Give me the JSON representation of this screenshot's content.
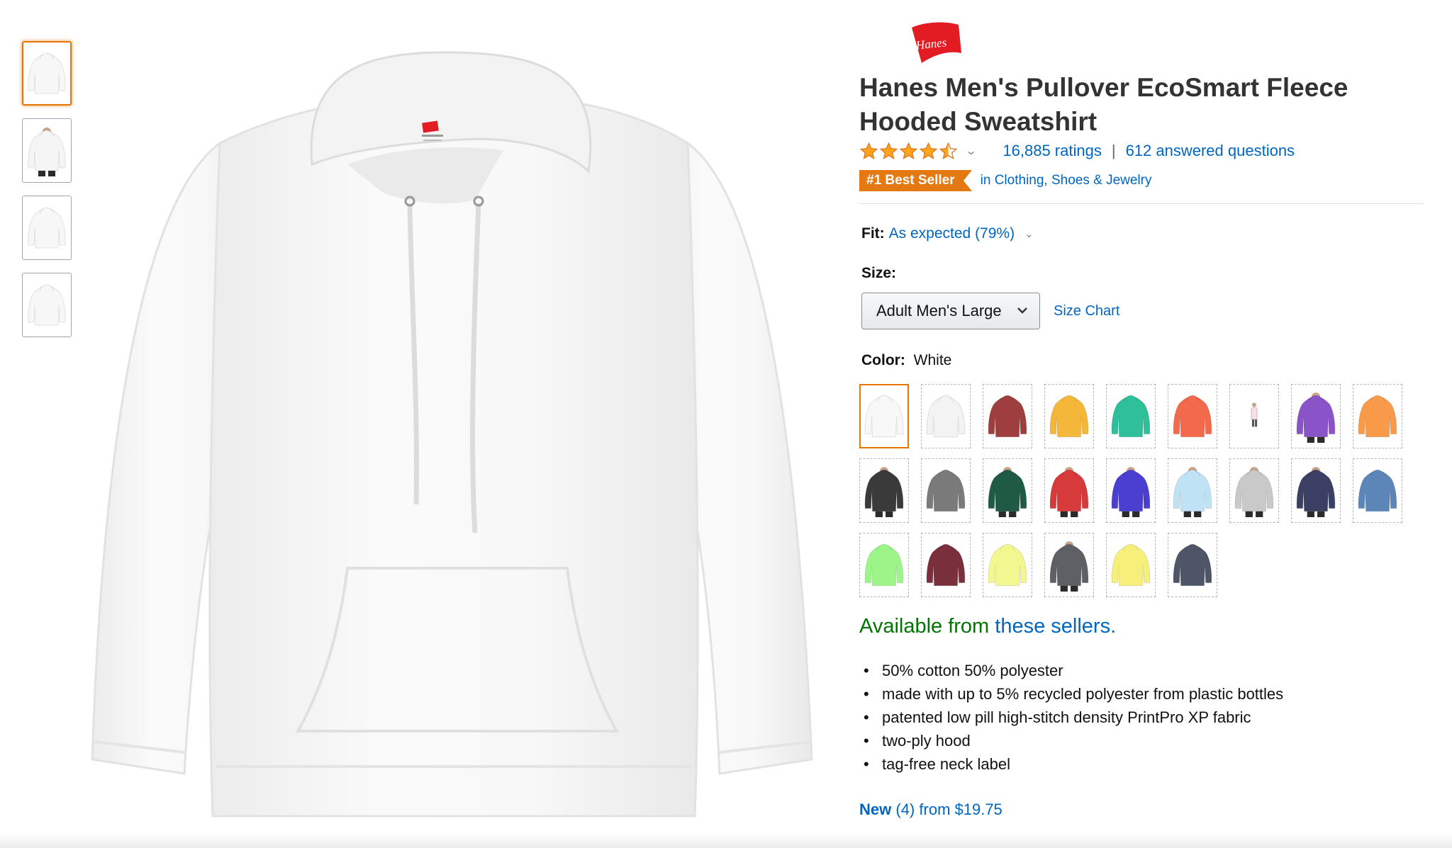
{
  "thumbnails": [
    {
      "name": "thumb-front-white",
      "selected": true,
      "body": "#f7f7f7",
      "person": false
    },
    {
      "name": "thumb-model-white",
      "selected": false,
      "body": "#f5f5f5",
      "person": true
    },
    {
      "name": "thumb-back-white",
      "selected": false,
      "body": "#f7f7f7",
      "person": false
    },
    {
      "name": "thumb-flat-white",
      "selected": false,
      "body": "#f7f7f7",
      "person": false
    }
  ],
  "brand": {
    "logo_text": "Hanes",
    "logo_color": "#e31b23"
  },
  "product": {
    "title": "Hanes Men's Pullover EcoSmart Fleece Hooded Sweatshirt",
    "rating": 4.5,
    "ratings_label": "16,885 ratings",
    "separator": "|",
    "questions_label": "612 answered questions",
    "best_seller_badge": "#1 Best Seller",
    "best_seller_category": "in Clothing, Shoes & Jewelry"
  },
  "fit": {
    "label": "Fit:",
    "value": "As expected (79%)"
  },
  "size": {
    "label": "Size:",
    "selected": "Adult Men's Large",
    "size_chart_label": "Size Chart"
  },
  "color": {
    "label": "Color:",
    "selected": "White",
    "swatches": [
      {
        "hex": "#f8f8f8",
        "person": false,
        "selected": true
      },
      {
        "hex": "#f3f3f3",
        "person": false,
        "selected": false
      },
      {
        "hex": "#9e3e3e",
        "person": false,
        "selected": false
      },
      {
        "hex": "#f4b73a",
        "person": false,
        "selected": false
      },
      {
        "hex": "#2fbf9a",
        "person": false,
        "selected": false
      },
      {
        "hex": "#f26a4b",
        "person": false,
        "selected": false
      },
      {
        "hex": "#f3e1e6",
        "person": "tiny",
        "selected": false
      },
      {
        "hex": "#8a54c8",
        "person": true,
        "selected": false
      },
      {
        "hex": "#f89a4a",
        "person": false,
        "selected": false
      },
      {
        "hex": "#3a3a3a",
        "person": true,
        "selected": false
      },
      {
        "hex": "#7a7a7a",
        "person": false,
        "selected": false
      },
      {
        "hex": "#1f5a45",
        "person": true,
        "selected": false
      },
      {
        "hex": "#d63a3a",
        "person": true,
        "selected": false
      },
      {
        "hex": "#4a3fd0",
        "person": true,
        "selected": false
      },
      {
        "hex": "#bfe3f5",
        "person": true,
        "selected": false
      },
      {
        "hex": "#c9c9c9",
        "person": true,
        "selected": false
      },
      {
        "hex": "#3b3f63",
        "person": true,
        "selected": false
      },
      {
        "hex": "#5d86b8",
        "person": false,
        "selected": false
      },
      {
        "hex": "#9df58a",
        "person": false,
        "selected": false
      },
      {
        "hex": "#7a2f3c",
        "person": false,
        "selected": false
      },
      {
        "hex": "#f3f78f",
        "person": false,
        "selected": false
      },
      {
        "hex": "#5f5f66",
        "person": true,
        "selected": false
      },
      {
        "hex": "#f6f07a",
        "person": false,
        "selected": false
      },
      {
        "hex": "#4d5566",
        "person": false,
        "selected": false
      }
    ]
  },
  "availability": {
    "prefix": "Available from",
    "link": "these sellers."
  },
  "features": [
    "50% cotton 50% polyester",
    "made with up to 5% recycled polyester from plastic bottles",
    "patented low pill high-stitch density PrintPro XP fabric",
    "two-ply hood",
    "tag-free neck label"
  ],
  "offers": {
    "new_label": "New",
    "count": "(4)",
    "from_text": "from $19.75"
  },
  "colors": {
    "link": "#0066c0",
    "orange": "#e47911",
    "green": "#007600",
    "star": "#ffa41c"
  }
}
